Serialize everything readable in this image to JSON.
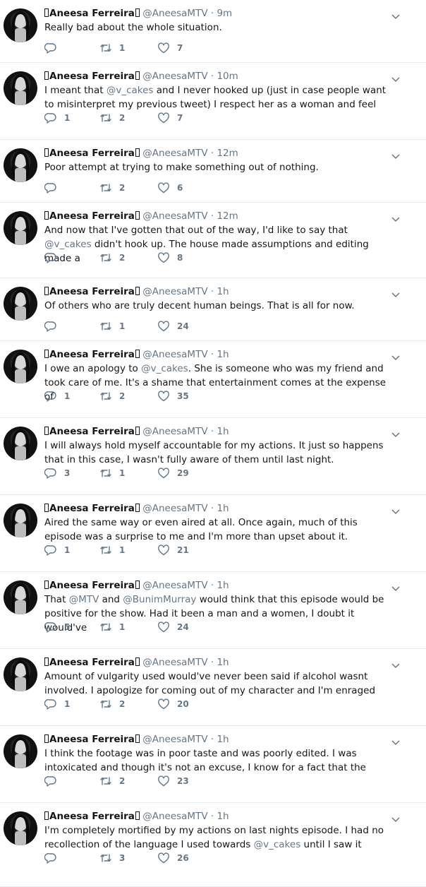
{
  "author": {
    "display_name": "Aneesa Ferreira",
    "handle": "@AneesaMTV",
    "separator": "·"
  },
  "tweets": [
    {
      "time": "9m",
      "text": "Really bad about the whole situation.",
      "replies": "",
      "retweets": "1",
      "likes": "7"
    },
    {
      "time": "10m",
      "text_parts": [
        "I meant that ",
        "@v_cakes",
        " and I never hooked up (just in case people want to misinterpret my previous tweet) I respect her as a woman and feel"
      ],
      "replies": "1",
      "retweets": "2",
      "likes": "7"
    },
    {
      "time": "12m",
      "text": "Poor attempt at trying to make something out of nothing.",
      "replies": "",
      "retweets": "2",
      "likes": "6"
    },
    {
      "time": "12m",
      "text_parts": [
        "And now that I've gotten that out of the way, I'd like to say that ",
        "@v_cakes",
        " didn't hook up. The house made assumptions and editing made a"
      ],
      "replies": "",
      "retweets": "2",
      "likes": "8"
    },
    {
      "time": "1h",
      "text": "Of others who are truly decent human beings. That is all for now.",
      "replies": "",
      "retweets": "1",
      "likes": "24"
    },
    {
      "time": "1h",
      "text_parts": [
        "I owe an apology to ",
        "@v_cakes",
        ". She is someone who was my friend and took care of me. It's a shame that entertainment comes at the expense of"
      ],
      "replies": "1",
      "retweets": "2",
      "likes": "35"
    },
    {
      "time": "1h",
      "text": "I will always hold myself accountable for my actions. It just so happens that in this case, I wasn't fully aware of them until last night.",
      "replies": "3",
      "retweets": "1",
      "likes": "29"
    },
    {
      "time": "1h",
      "text": "Aired the same way or even aired at all. Once again, much of this episode was a surprise to me and I'm more than upset about it.",
      "replies": "1",
      "retweets": "1",
      "likes": "21"
    },
    {
      "time": "1h",
      "text_parts": [
        "That ",
        "@MTV",
        " and ",
        "@BunimMurray",
        " would think that this episode would be positive for the show. Had it been a man and a women, I doubt it would've"
      ],
      "replies": "5",
      "retweets": "1",
      "likes": "24"
    },
    {
      "time": "1h",
      "text": "Amount of vulgarity used would've never been said if alcohol wasnt involved. I apologize for coming out of my character and I'm enraged",
      "replies": "1",
      "retweets": "2",
      "likes": "20"
    },
    {
      "time": "1h",
      "text": "I think the footage was in poor taste and was poorly edited. I was intoxicated and though it's not an excuse, I know for a fact that the",
      "replies": "",
      "retweets": "2",
      "likes": "23"
    },
    {
      "time": "1h",
      "text_parts": [
        "I'm completely mortified by my actions on last nights episode. I had no recollection of the language I used towards ",
        "@v_cakes",
        " until I saw it"
      ],
      "replies": "",
      "retweets": "3",
      "likes": "26"
    }
  ],
  "icons": {
    "reply": "reply-icon",
    "retweet": "retweet-icon",
    "like": "heart-icon",
    "more": "chevron-down-icon"
  },
  "colors": {
    "text": "#14171a",
    "muted": "#657786",
    "divider": "#e6ecf0"
  }
}
